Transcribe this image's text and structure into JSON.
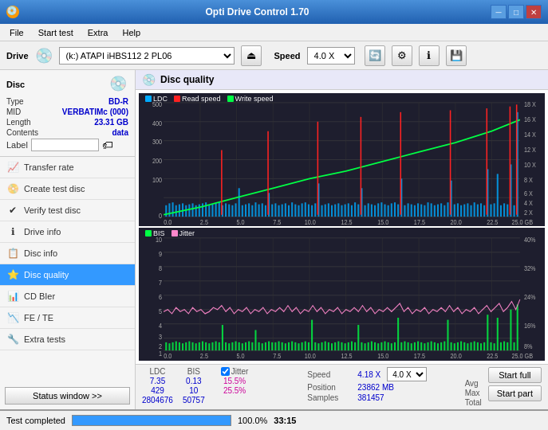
{
  "titleBar": {
    "title": "Opti Drive Control 1.70",
    "icon": "💿",
    "minimizeBtn": "─",
    "maximizeBtn": "□",
    "closeBtn": "✕"
  },
  "menuBar": {
    "items": [
      "File",
      "Start test",
      "Extra",
      "Help"
    ]
  },
  "driveBar": {
    "driveLabel": "Drive",
    "driveValue": "(k:) ATAPI iHBS112  2 PL06",
    "speedLabel": "Speed",
    "speedValue": "4.0 X"
  },
  "discInfo": {
    "title": "Disc",
    "type": {
      "label": "Type",
      "value": "BD-R"
    },
    "mid": {
      "label": "MID",
      "value": "VERBATIMc (000)"
    },
    "length": {
      "label": "Length",
      "value": "23.31 GB"
    },
    "contents": {
      "label": "Contents",
      "value": "data"
    },
    "labelLabel": "Label"
  },
  "navItems": [
    {
      "id": "transfer-rate",
      "label": "Transfer rate",
      "icon": "📈"
    },
    {
      "id": "create-test-disc",
      "label": "Create test disc",
      "icon": "📀"
    },
    {
      "id": "verify-test-disc",
      "label": "Verify test disc",
      "icon": "✔"
    },
    {
      "id": "drive-info",
      "label": "Drive info",
      "icon": "ℹ"
    },
    {
      "id": "disc-info",
      "label": "Disc info",
      "icon": "📋"
    },
    {
      "id": "disc-quality",
      "label": "Disc quality",
      "icon": "⭐",
      "active": true
    },
    {
      "id": "cd-bier",
      "label": "CD BIer",
      "icon": "📊"
    },
    {
      "id": "fe-te",
      "label": "FE / TE",
      "icon": "📉"
    },
    {
      "id": "extra-tests",
      "label": "Extra tests",
      "icon": "🔧"
    }
  ],
  "statusWindowBtn": "Status window >>",
  "discQuality": {
    "title": "Disc quality",
    "chart1": {
      "legend": [
        {
          "label": "LDC",
          "color": "#00aaff"
        },
        {
          "label": "Read speed",
          "color": "#ff2222"
        },
        {
          "label": "Write speed",
          "color": "#00ff44"
        }
      ],
      "yAxisRight": [
        "18 X",
        "16 X",
        "14 X",
        "12 X",
        "10 X",
        "8 X",
        "6 X",
        "4 X",
        "2 X"
      ],
      "yAxisLeft": [
        "500",
        "400",
        "300",
        "200",
        "100",
        "0"
      ],
      "xAxis": [
        "0.0",
        "2.5",
        "5.0",
        "7.5",
        "10.0",
        "12.5",
        "15.0",
        "17.5",
        "20.0",
        "22.5",
        "25.0 GB"
      ]
    },
    "chart2": {
      "legend": [
        {
          "label": "BIS",
          "color": "#00ff44"
        },
        {
          "label": "Jitter",
          "color": "#ff88cc"
        }
      ],
      "yAxisRight": [
        "40%",
        "32%",
        "24%",
        "16%",
        "8%"
      ],
      "yAxisLeft": [
        "10",
        "9",
        "8",
        "7",
        "6",
        "5",
        "4",
        "3",
        "2",
        "1"
      ],
      "xAxis": [
        "0.0",
        "2.5",
        "5.0",
        "7.5",
        "10.0",
        "12.5",
        "15.0",
        "17.5",
        "20.0",
        "22.5",
        "25.0 GB"
      ]
    },
    "stats": {
      "ldcLabel": "LDC",
      "bisLabel": "BIS",
      "jitterLabel": "Jitter",
      "speedLabel": "Speed",
      "positionLabel": "Position",
      "samplesLabel": "Samples",
      "avgLabel": "Avg",
      "maxLabel": "Max",
      "totalLabel": "Total",
      "ldcAvg": "7.35",
      "ldcMax": "429",
      "ldcTotal": "2804676",
      "bisAvg": "0.13",
      "bisMax": "10",
      "bisTotal": "50757",
      "jitterAvg": "15.5%",
      "jitterMax": "25.5%",
      "jitterTotal": "",
      "speedValue": "4.18 X",
      "speedSelect": "4.0 X",
      "positionValue": "23862 MB",
      "samplesValue": "381457"
    },
    "buttons": {
      "startFull": "Start full",
      "startPart": "Start part"
    }
  },
  "statusBar": {
    "text": "Test completed",
    "progress": 100.0,
    "progressText": "100.0%",
    "time": "33:15"
  }
}
